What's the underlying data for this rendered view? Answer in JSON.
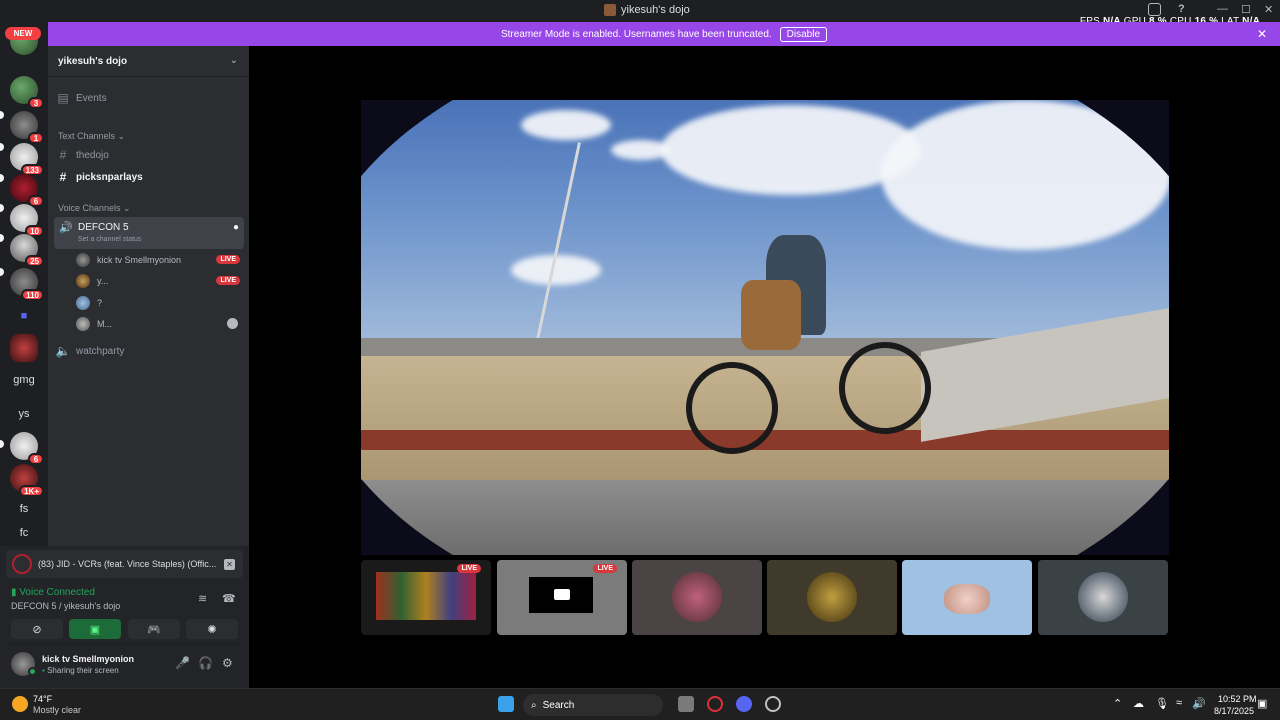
{
  "titlebar": {
    "title": "yikesuh's dojo"
  },
  "perf": {
    "fps_label": "FPS",
    "fps": "N/A",
    "gpu_label": "GPU",
    "gpu": "8 %",
    "cpu_label": "CPU",
    "cpu": "16 %",
    "lat_label": "LAT",
    "lat": "N/A"
  },
  "banner": {
    "text": "Streamer Mode is enabled. Usernames have been truncated.",
    "button": "Disable"
  },
  "rail": {
    "new_badge": "NEW",
    "badges": [
      "3",
      "1",
      "133",
      "6",
      "10",
      "25",
      "110",
      "6",
      "1K+"
    ],
    "text_servers": [
      "gmg",
      "ys",
      "fs",
      "fc"
    ]
  },
  "channels": {
    "server_name": "yikesuh's dojo",
    "events": "Events",
    "text_category": "Text Channels",
    "text_channels": [
      "thedojo",
      "picksnparlays"
    ],
    "voice_category": "Voice Channels",
    "voice_channel": "DEFCON 5",
    "voice_status": "Set a channel status",
    "voice_users": [
      "kick tv Smellmyonion",
      "y...",
      "?",
      "M..."
    ],
    "live": "LIVE",
    "other_voice": "watchparty"
  },
  "panel": {
    "now_playing": "(83) JID - VCRs (feat. Vince Staples) (Offic...",
    "voice_connected": "Voice Connected",
    "voice_location": "DEFCON 5 / yikesuh's dojo",
    "user": "kick tv Smellmyonion",
    "user_status": "Sharing their screen"
  },
  "thumbnails": {
    "live": "LIVE"
  },
  "taskbar": {
    "temp": "74°F",
    "weather": "Mostly clear",
    "search": "Search",
    "time": "10:52 PM",
    "date": "8/17/2025"
  }
}
